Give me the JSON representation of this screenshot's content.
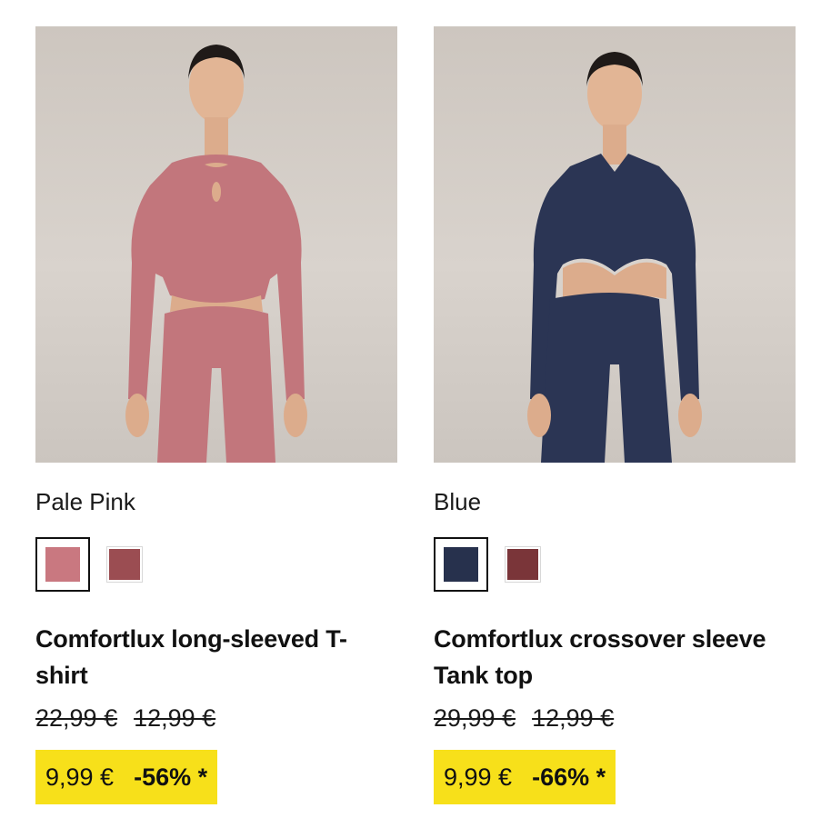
{
  "colors": {
    "sale_highlight": "#f7e01a",
    "text": "#111111"
  },
  "products": [
    {
      "color_name": "Pale Pink",
      "swatches": [
        {
          "name": "pale-pink",
          "hex": "#c97880",
          "selected": true
        },
        {
          "name": "burgundy",
          "hex": "#9b4d52",
          "selected": false
        }
      ],
      "title": "Comfortlux long-sleeved T-shirt",
      "old_prices": [
        "22,99 €",
        "12,99 €"
      ],
      "price": "9,99 €",
      "discount": "-56% *",
      "garment_color": "#c2767c"
    },
    {
      "color_name": "Blue",
      "swatches": [
        {
          "name": "navy",
          "hex": "#27314d",
          "selected": true
        },
        {
          "name": "burgundy",
          "hex": "#7a3539",
          "selected": false
        }
      ],
      "title": "Comfortlux crossover sleeve Tank top",
      "old_prices": [
        "29,99 €",
        "12,99 €"
      ],
      "price": "9,99 €",
      "discount": "-66% *",
      "garment_color": "#2b3554"
    }
  ]
}
